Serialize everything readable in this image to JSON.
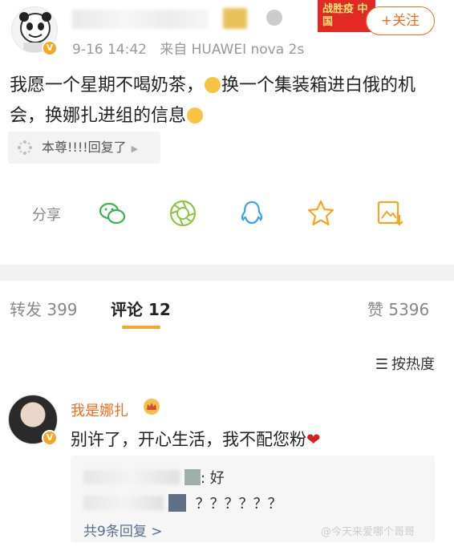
{
  "post": {
    "meta_time": "9-16 14:42",
    "meta_from": "来自 HUAWEI nova 2s",
    "follow_label": "+关注",
    "campaign_label": "战胜疫 中国",
    "content_part1": "我愿一个星期不喝奶茶，",
    "content_part2": "换一个集装箱进白俄的机会，换娜扎进组的信息",
    "reply_chip": "本尊!!!!回复了",
    "share_label": "分享",
    "share_icons": [
      "wechat-icon",
      "moments-icon",
      "qq-icon",
      "favorite-star-icon",
      "save-image-icon"
    ]
  },
  "tabs": [
    {
      "label": "转发 399"
    },
    {
      "label": "评论 12"
    },
    {
      "label": "赞 5396"
    }
  ],
  "comments": {
    "sort_label": "按热度",
    "items": [
      {
        "name": "我是娜扎",
        "text": "别许了，开心生活，我不配您粉",
        "heart": "❤",
        "subreplies": [
          {
            "text": ": 好"
          },
          {
            "text": "？？？？？？"
          }
        ],
        "view_all": "共9条回复 >"
      }
    ]
  },
  "watermark": "@今天来爱哪个哥哥",
  "colors": {
    "accent_orange": "#f36b1e",
    "tab_underline": "#f5a623",
    "link_blue": "#5a6f8c"
  }
}
